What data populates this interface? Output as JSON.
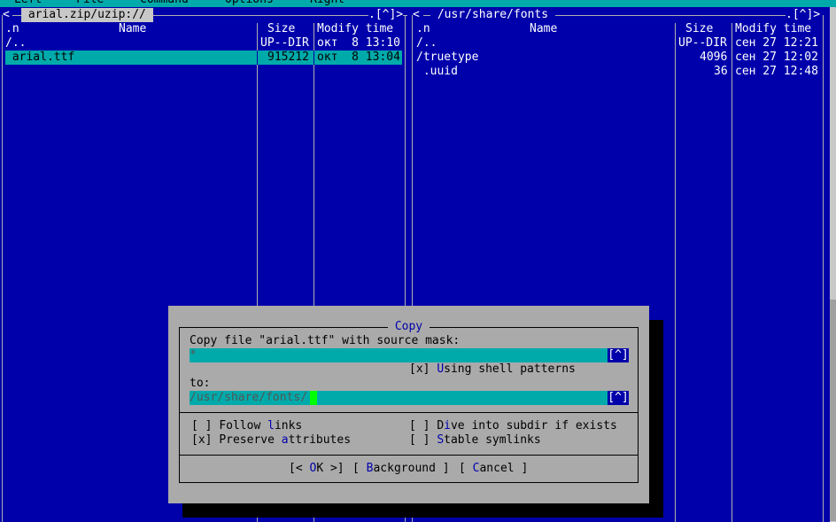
{
  "menu": [
    "Left",
    "File",
    "Command",
    "Options",
    "Right"
  ],
  "left_panel": {
    "path": " arial.zip/uzip:// ",
    "corner_left": "<",
    "corner_right": ".[^]>",
    "headers": {
      "name_col": ".n",
      "name": "Name",
      "size": "Size",
      "mtime": "Modify time"
    },
    "rows": [
      {
        "name": "/..",
        "size": "UP--DIR",
        "mtime": "окт  8 13:10"
      },
      {
        "name": " arial.ttf",
        "size": "915212",
        "mtime": "окт  8 13:04"
      }
    ]
  },
  "right_panel": {
    "path": " /usr/share/fonts ",
    "corner_left": "<",
    "corner_right": ".[^]>",
    "headers": {
      "name_col": ".n",
      "name": "Name",
      "size": "Size",
      "mtime": "Modify time"
    },
    "rows": [
      {
        "name": "/..",
        "size": "UP--DIR",
        "mtime": "сен 27 12:21"
      },
      {
        "name": "/truetype",
        "size": "4096",
        "mtime": "сен 27 12:02"
      },
      {
        "name": " .uuid",
        "size": "36",
        "mtime": "сен 27 12:48"
      }
    ]
  },
  "dialog": {
    "title": " Copy ",
    "prompt": "Copy file \"arial.ttf\" with source mask:",
    "source_mask": "*",
    "history_btn": "[^]",
    "shell_patterns": {
      "box": "[x] ",
      "hot": "U",
      "rest": "sing shell patterns"
    },
    "to_label": "to:",
    "destination": "/usr/share/fonts/",
    "follow_links": {
      "box": "[ ] ",
      "pre": "Follow ",
      "hot": "l",
      "post": "inks"
    },
    "preserve_attributes": {
      "box": "[x] ",
      "pre": "Preserve ",
      "hot": "a",
      "post": "ttributes"
    },
    "dive_into_subdir": {
      "box": "[ ] ",
      "pre": "D",
      "hot": "i",
      "post": "ve into subdir if exists"
    },
    "stable_symlinks": {
      "box": "[ ] ",
      "pre": "",
      "hot": "S",
      "post": "table symlinks"
    },
    "ok": {
      "pre": "[< ",
      "hot": "O",
      "post": "K >]"
    },
    "background": {
      "pre": "[ ",
      "hot": "B",
      "post": "ackground ]"
    },
    "cancel": {
      "pre": "[ ",
      "hot": "C",
      "post": "ancel ]"
    }
  }
}
